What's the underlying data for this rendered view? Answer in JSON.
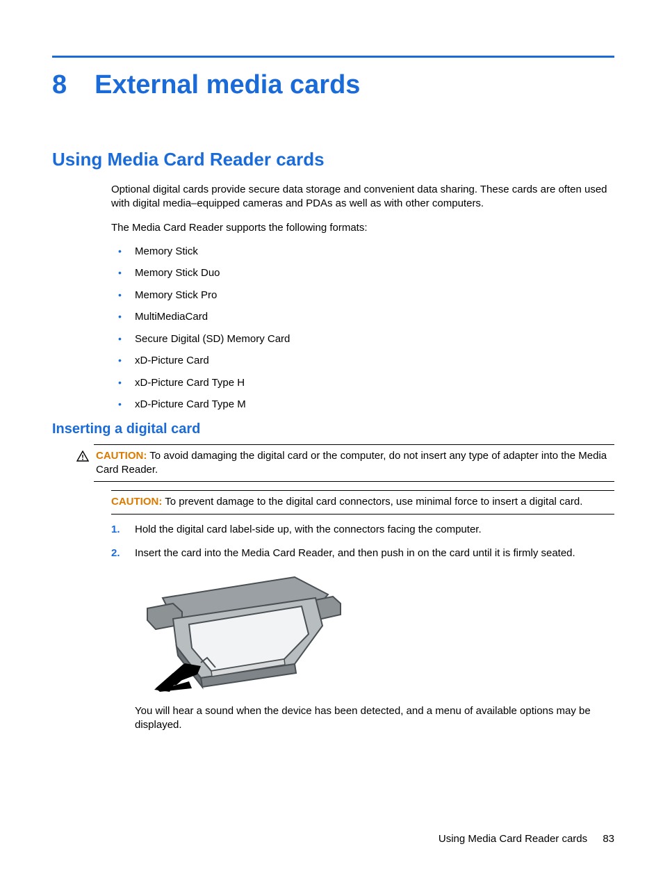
{
  "chapter": {
    "number": "8",
    "title": "External media cards"
  },
  "section": {
    "title": "Using Media Card Reader cards"
  },
  "intro": {
    "p1": "Optional digital cards provide secure data storage and convenient data sharing. These cards are often used with digital media–equipped cameras and PDAs as well as with other computers.",
    "p2": "The Media Card Reader supports the following formats:"
  },
  "formats": [
    "Memory Stick",
    "Memory Stick Duo",
    "Memory Stick Pro",
    "MultiMediaCard",
    "Secure Digital (SD) Memory Card",
    "xD-Picture Card",
    "xD-Picture Card Type H",
    "xD-Picture Card Type M"
  ],
  "subsection": {
    "title": "Inserting a digital card"
  },
  "caution1": {
    "label": "CAUTION:",
    "text": "To avoid damaging the digital card or the computer, do not insert any type of adapter into the Media Card Reader."
  },
  "caution2": {
    "label": "CAUTION:",
    "text": "To prevent damage to the digital card connectors, use minimal force to insert a digital card."
  },
  "steps": [
    "Hold the digital card label-side up, with the connectors facing the computer.",
    "Insert the card into the Media Card Reader, and then push in on the card until it is firmly seated."
  ],
  "afterNote": "You will hear a sound when the device has been detected, and a menu of available options may be displayed.",
  "footer": {
    "text": "Using Media Card Reader cards",
    "page": "83"
  }
}
